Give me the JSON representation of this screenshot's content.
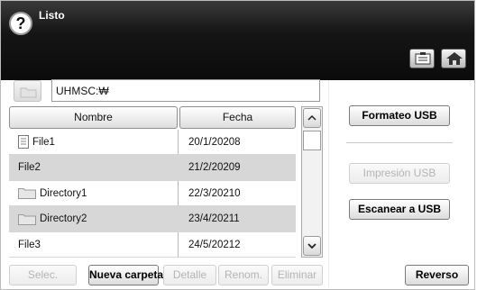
{
  "header": {
    "status": "Listo"
  },
  "path": {
    "value": "UHMSC:₩"
  },
  "table": {
    "columns": [
      "Nombre",
      "Fecha"
    ],
    "rows": [
      {
        "name": "File1",
        "date": "20/1/20208",
        "icon": "file-icon"
      },
      {
        "name": "File2",
        "date": "21/2/20209",
        "icon": ""
      },
      {
        "name": "Directory1",
        "date": "22/3/20210",
        "icon": "folder-icon"
      },
      {
        "name": "Directory2",
        "date": "23/4/20211",
        "icon": "folder-icon"
      },
      {
        "name": "File3",
        "date": "24/5/20212",
        "icon": ""
      }
    ]
  },
  "buttons": {
    "select": "Selec.",
    "new_folder": "Nueva carpeta",
    "detail": "Detalle",
    "rename": "Renom.",
    "delete": "Eliminar",
    "format_usb": "Formateo USB",
    "print_usb": "Impresión USB",
    "scan_to_usb": "Escanear a USB",
    "back": "Reverso"
  },
  "colors": {
    "header": "#111111",
    "row_alt": "#d7d7d7",
    "disabled_text": "#b4b4b4"
  }
}
